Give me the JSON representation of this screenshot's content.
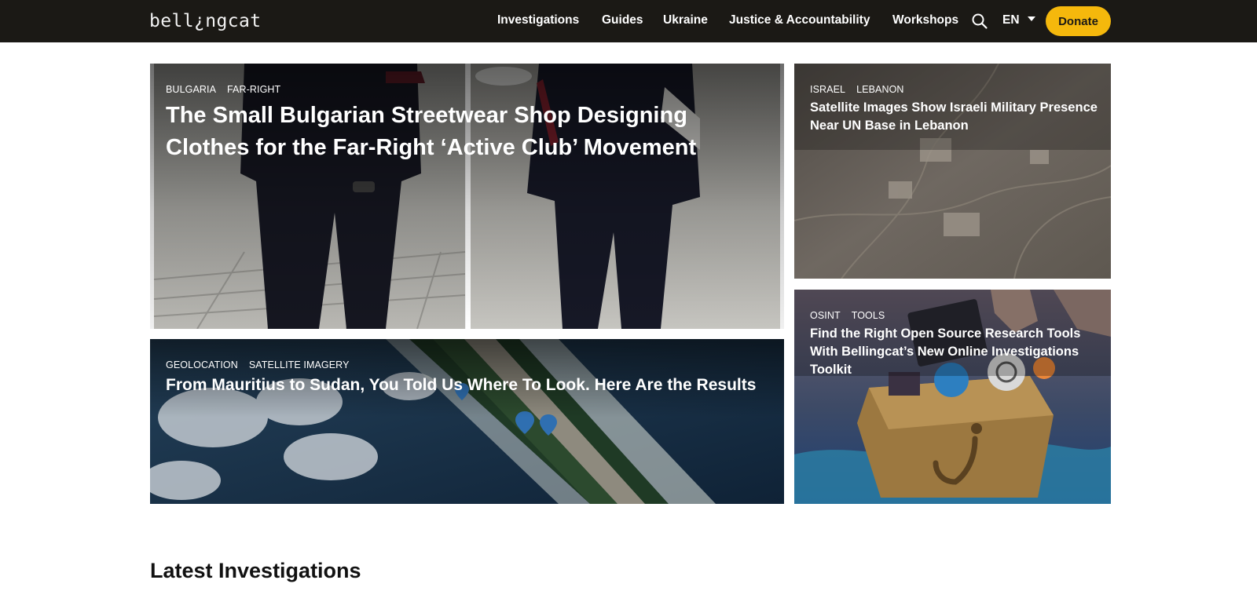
{
  "header": {
    "logo_text": "bell¿ngcat",
    "nav": [
      "Investigations",
      "Guides",
      "Ukraine",
      "Justice & Accountability",
      "Workshops"
    ],
    "search_icon": "search-icon",
    "language": "EN",
    "donate_label": "Donate",
    "colors": {
      "bar": "#1b1915",
      "accent": "#f5b80c"
    }
  },
  "featured": [
    {
      "tags": [
        "BULGARIA",
        "FAR-RIGHT"
      ],
      "title": "The Small Bulgarian Streetwear Shop Designing Clothes for the Far-Right ‘Active Club’ Movement"
    },
    {
      "tags": [
        "ISRAEL",
        "LEBANON"
      ],
      "title": "Satellite Images Show Israeli Military Presence Near UN Base in Lebanon"
    },
    {
      "tags": [
        "GEOLOCATION",
        "SATELLITE IMAGERY"
      ],
      "title": "From Mauritius to Sudan, You Told Us Where To Look. Here Are the Results"
    },
    {
      "tags": [
        "OSINT",
        "TOOLS"
      ],
      "title": "Find the Right Open Source Research Tools With Bellingcat’s New Online Investigations Toolkit"
    }
  ],
  "section": {
    "title": "Latest Investigations"
  }
}
